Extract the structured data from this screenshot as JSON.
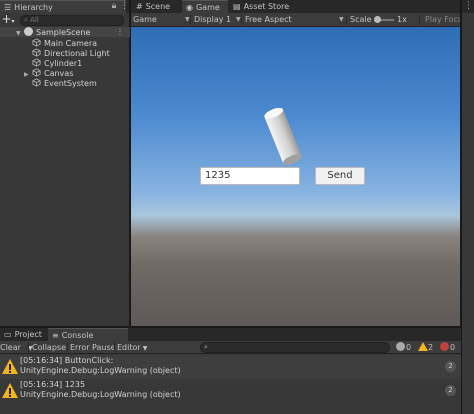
{
  "hierarchy": {
    "tab_label": "Hierarchy",
    "search_placeholder": "All",
    "scene_name": "SampleScene",
    "items": [
      {
        "label": "Main Camera"
      },
      {
        "label": "Directional Light"
      },
      {
        "label": "Cylinder1"
      },
      {
        "label": "Canvas"
      },
      {
        "label": "EventSystem"
      }
    ]
  },
  "top_tabs": {
    "scene": "Scene",
    "game": "Game",
    "asset_store": "Asset Store"
  },
  "game_toolbar": {
    "mode": "Game",
    "display": "Display 1",
    "aspect": "Free Aspect",
    "scale_label": "Scale",
    "scale_value": "1x",
    "play_focused": "Play Focu"
  },
  "game_view": {
    "input_value": "1235",
    "button_label": "Send"
  },
  "console": {
    "tabs": {
      "project": "Project",
      "console": "Console"
    },
    "toolbar": {
      "clear": "Clear",
      "collapse": "Collapse",
      "error_pause": "Error Pause",
      "editor": "Editor"
    },
    "counts": {
      "info": "0",
      "warnings": "2",
      "errors": "0"
    },
    "logs": [
      {
        "line1": "[05:16:34] ButtonClick:",
        "line2": "UnityEngine.Debug:LogWarning (object)",
        "count": "2"
      },
      {
        "line1": "[05:16:34] 1235",
        "line2": "UnityEngine.Debug:LogWarning (object)",
        "count": "2"
      }
    ]
  },
  "colors": {
    "panel": "#383838",
    "warning": "#f2b51d",
    "sky_top": "#2e6db5",
    "ground": "#6f6a66"
  }
}
